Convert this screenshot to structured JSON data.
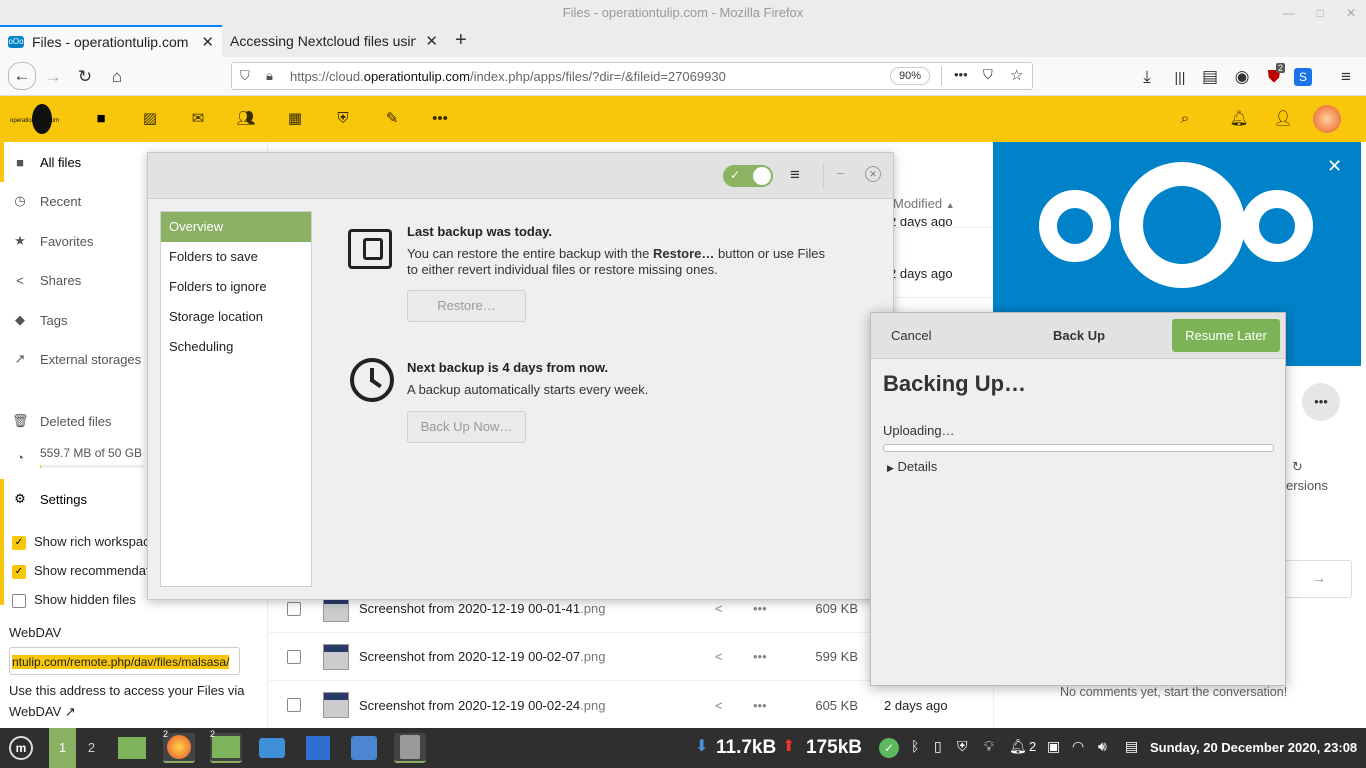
{
  "window": {
    "title": "Files - operationtulip.com - Mozilla Firefox"
  },
  "browser": {
    "tabs": [
      {
        "label": "Files - operationtulip.com"
      },
      {
        "label": "Accessing Nextcloud files using"
      }
    ],
    "url_prefix": "https://cloud.",
    "url_domain": "operationtulip.com",
    "url_suffix": "/index.php/apps/files/?dir=/&fileid=27069930",
    "zoom": "90%",
    "badge_count": "2"
  },
  "nextcloud": {
    "logo_text": "operationtulip.com",
    "sidebar": {
      "items": [
        {
          "label": "All files",
          "icon": "folder-icon"
        },
        {
          "label": "Recent",
          "icon": "clock-icon"
        },
        {
          "label": "Favorites",
          "icon": "star-icon"
        },
        {
          "label": "Shares",
          "icon": "share-icon"
        },
        {
          "label": "Tags",
          "icon": "tag-icon"
        },
        {
          "label": "External storages",
          "icon": "external-icon"
        },
        {
          "label": "Deleted files",
          "icon": "trash-icon"
        }
      ],
      "quota": "559.7 MB of 50 GB",
      "quota_fraction": 0.011,
      "settings_label": "Settings",
      "options": [
        {
          "label": "Show rich workspaces",
          "checked": true
        },
        {
          "label": "Show recommendations",
          "checked": true
        },
        {
          "label": "Show hidden files",
          "checked": false
        }
      ],
      "webdav_label": "WebDAV",
      "webdav_url": "ntulip.com/remote.php/dav/files/malsasa/",
      "webdav_help": "Use this address to access your Files via",
      "webdav_link": "WebDAV ↗"
    },
    "files": {
      "modified_header": "Modified",
      "partial_rows": [
        {
          "modified": "2 days ago"
        },
        {
          "modified": "2 days ago"
        }
      ],
      "rows": [
        {
          "name": "Screenshot from 2020-12-19 00-01-41",
          "ext": ".png",
          "size": "609 KB",
          "modified": ""
        },
        {
          "name": "Screenshot from 2020-12-19 00-02-07",
          "ext": ".png",
          "size": "599 KB",
          "modified": ""
        },
        {
          "name": "Screenshot from 2020-12-19 00-02-24",
          "ext": ".png",
          "size": "605 KB",
          "modified": "2 days ago"
        }
      ]
    },
    "right_panel": {
      "versions_label": "ersions",
      "no_comments": "No comments yet, start the conversation!"
    }
  },
  "deja_dup": {
    "nav": [
      "Overview",
      "Folders to save",
      "Folders to ignore",
      "Storage location",
      "Scheduling"
    ],
    "last_backup_title": "Last backup was today.",
    "last_backup_text1": "You can restore the entire backup with the",
    "last_backup_bold": "Restore…",
    "last_backup_text2": "button or use Files",
    "last_backup_text3": "to either revert individual files or restore missing ones.",
    "restore_button": "Restore…",
    "next_backup_title": "Next backup is 4 days from now.",
    "next_backup_text": "A backup automatically starts every week.",
    "backup_now_button": "Back Up Now…"
  },
  "backup_dialog": {
    "cancel": "Cancel",
    "title": "Back Up",
    "resume": "Resume Later",
    "heading": "Backing Up…",
    "status": "Uploading…",
    "progress": 0.0,
    "details": "Details"
  },
  "taskbar": {
    "workspaces": [
      "1",
      "2"
    ],
    "download_speed": "11.7kB",
    "upload_speed": "175kB",
    "notif_count": "2",
    "clock": "Sunday, 20 December 2020, 23:08",
    "badge_a": "2",
    "badge_b": "2"
  }
}
